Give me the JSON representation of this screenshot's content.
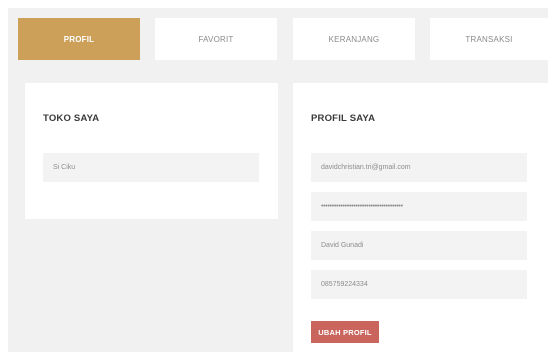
{
  "colors": {
    "accent": "#cca059",
    "danger_button": "#c9655d"
  },
  "tabs": [
    {
      "label": "PROFIL",
      "active": true
    },
    {
      "label": "FAVORIT",
      "active": false
    },
    {
      "label": "KERANJANG",
      "active": false
    },
    {
      "label": "TRANSAKSI",
      "active": false
    }
  ],
  "shop_card": {
    "title": "TOKO SAYA",
    "shop_name_value": "Si Ciku"
  },
  "profile_card": {
    "title": "PROFIL SAYA",
    "email_value": "davidchristian.tri@gmail.com",
    "password_value": "••••••••••••••••••••••••••••••••••••••",
    "name_value": "David Gunadi",
    "phone_value": "085759224334",
    "update_button_label": "UBAH PROFIL"
  }
}
